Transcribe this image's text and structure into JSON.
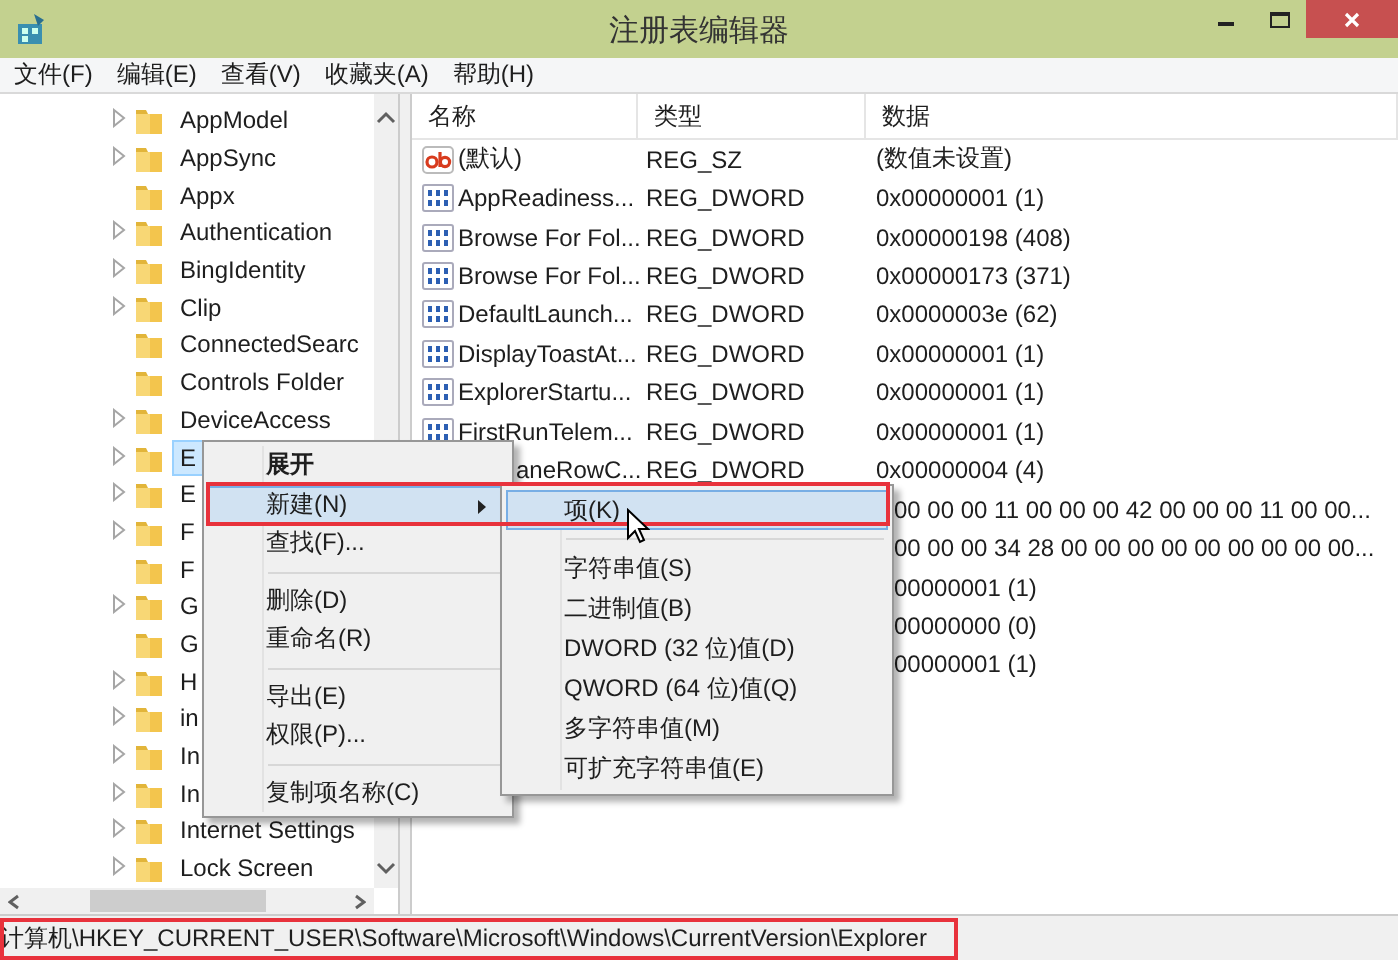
{
  "window": {
    "title": "注册表编辑器"
  },
  "menu_bar": [
    "文件(F)",
    "编辑(E)",
    "查看(V)",
    "收藏夹(A)",
    "帮助(H)"
  ],
  "tree": {
    "items": [
      {
        "label": "AppModel",
        "expandable": true,
        "selected": false
      },
      {
        "label": "AppSync",
        "expandable": true,
        "selected": false
      },
      {
        "label": "Appx",
        "expandable": false,
        "selected": false
      },
      {
        "label": "Authentication",
        "expandable": true,
        "selected": false
      },
      {
        "label": "BingIdentity",
        "expandable": true,
        "selected": false
      },
      {
        "label": "Clip",
        "expandable": true,
        "selected": false
      },
      {
        "label": "ConnectedSearc",
        "expandable": false,
        "selected": false
      },
      {
        "label": "Controls Folder",
        "expandable": false,
        "selected": false
      },
      {
        "label": "DeviceAccess",
        "expandable": true,
        "selected": false
      },
      {
        "label": "E",
        "expandable": true,
        "selected": true
      },
      {
        "label": "E",
        "expandable": true,
        "selected": false
      },
      {
        "label": "F",
        "expandable": true,
        "selected": false
      },
      {
        "label": "F",
        "expandable": false,
        "selected": false
      },
      {
        "label": "G",
        "expandable": true,
        "selected": false
      },
      {
        "label": "G",
        "expandable": false,
        "selected": false
      },
      {
        "label": "H",
        "expandable": true,
        "selected": false
      },
      {
        "label": "in",
        "expandable": true,
        "selected": false
      },
      {
        "label": "In",
        "expandable": true,
        "selected": false
      },
      {
        "label": "In",
        "expandable": true,
        "selected": false
      },
      {
        "label": "Internet Settings",
        "expandable": true,
        "selected": false
      },
      {
        "label": "Lock Screen",
        "expandable": true,
        "selected": false
      }
    ]
  },
  "table": {
    "columns": [
      "名称",
      "类型",
      "数据"
    ],
    "rows": [
      {
        "kind": "string",
        "name": "(默认)",
        "type": "REG_SZ",
        "data": "(数值未设置)"
      },
      {
        "kind": "binary",
        "name": "AppReadiness...",
        "type": "REG_DWORD",
        "data": "0x00000001 (1)"
      },
      {
        "kind": "binary",
        "name": "Browse For Fol...",
        "type": "REG_DWORD",
        "data": "0x00000198 (408)"
      },
      {
        "kind": "binary",
        "name": "Browse For Fol...",
        "type": "REG_DWORD",
        "data": "0x00000173 (371)"
      },
      {
        "kind": "binary",
        "name": "DefaultLaunch...",
        "type": "REG_DWORD",
        "data": "0x0000003e (62)"
      },
      {
        "kind": "binary",
        "name": "DisplayToastAt...",
        "type": "REG_DWORD",
        "data": "0x00000001 (1)"
      },
      {
        "kind": "binary",
        "name": "ExplorerStartu...",
        "type": "REG_DWORD",
        "data": "0x00000001 (1)"
      },
      {
        "kind": "binary",
        "name": "FirstRunTelem...",
        "type": "REG_DWORD",
        "data": "0x00000001 (1)"
      },
      {
        "name": "aneRowC...",
        "type": "REG_DWORD",
        "data": "0x00000004 (4)"
      },
      {
        "data": "00 00 00 11 00 00 00 42 00 00 00 11 00 00..."
      },
      {
        "data": "00 00 00 34 28 00 00 00 00 00 00 00 00 00..."
      },
      {
        "data": "00000001 (1)"
      },
      {
        "data": "00000000 (0)"
      },
      {
        "data": "00000001 (1)"
      }
    ]
  },
  "context_menu": {
    "items": [
      {
        "kind": "item",
        "label": "展开",
        "default": true,
        "selected": false,
        "submenu": false,
        "marked": false
      },
      {
        "kind": "item",
        "label": "新建(N)",
        "default": false,
        "selected": true,
        "submenu": true,
        "marked": true
      },
      {
        "kind": "item",
        "label": "查找(F)...",
        "default": false,
        "selected": false,
        "submenu": false,
        "marked": false
      },
      {
        "kind": "separator"
      },
      {
        "kind": "item",
        "label": "删除(D)",
        "default": false,
        "selected": false,
        "submenu": false,
        "marked": false
      },
      {
        "kind": "item",
        "label": "重命名(R)",
        "default": false,
        "selected": false,
        "submenu": false,
        "marked": false
      },
      {
        "kind": "separator"
      },
      {
        "kind": "item",
        "label": "导出(E)",
        "default": false,
        "selected": false,
        "submenu": false,
        "marked": false
      },
      {
        "kind": "item",
        "label": "权限(P)...",
        "default": false,
        "selected": false,
        "submenu": false,
        "marked": false
      },
      {
        "kind": "separator"
      },
      {
        "kind": "item",
        "label": "复制项名称(C)",
        "default": false,
        "selected": false,
        "submenu": false,
        "marked": false
      }
    ]
  },
  "submenu": {
    "items": [
      {
        "kind": "item",
        "label": "项(K)",
        "default": false,
        "selected": true,
        "submenu": false
      },
      {
        "kind": "separator"
      },
      {
        "kind": "item",
        "label": "字符串值(S)",
        "default": false,
        "selected": false,
        "submenu": false
      },
      {
        "kind": "item",
        "label": "二进制值(B)",
        "default": false,
        "selected": false,
        "submenu": false
      },
      {
        "kind": "item",
        "label": "DWORD (32 位)值(D)",
        "default": false,
        "selected": false,
        "submenu": false
      },
      {
        "kind": "item",
        "label": "QWORD (64 位)值(Q)",
        "default": false,
        "selected": false,
        "submenu": false
      },
      {
        "kind": "item",
        "label": "多字符串值(M)",
        "default": false,
        "selected": false,
        "submenu": false
      },
      {
        "kind": "item",
        "label": "可扩充字符串值(E)",
        "default": false,
        "selected": false,
        "submenu": false
      }
    ]
  },
  "status_bar": {
    "path": "计算机\\HKEY_CURRENT_USER\\Software\\Microsoft\\Windows\\CurrentVersion\\Explorer",
    "marked": true
  }
}
